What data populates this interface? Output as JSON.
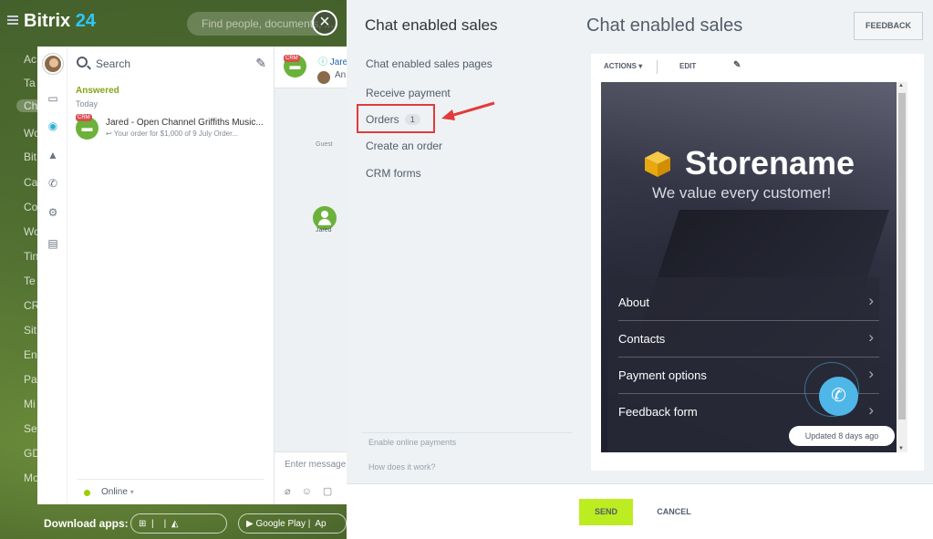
{
  "header": {
    "logo_main": "Bitrix",
    "logo_num": "24",
    "search_placeholder": "Find people, documents, ..."
  },
  "left_menu": [
    "Ac",
    "Ta",
    "Ch",
    "Wo",
    "Bit",
    "Ca",
    "Co",
    "Wo",
    "Tin",
    "Te",
    "CR",
    "Sit",
    "En",
    "Pa",
    "Mi",
    "Se",
    "GD",
    "Mo"
  ],
  "messenger": {
    "search_label": "Search",
    "section": "Answered",
    "date": "Today",
    "chat": {
      "badge": "CRM",
      "name": "Jared - Open Channel Griffiths Music...",
      "preview": "↩ Your order for $1,000 of 9 July Order..."
    },
    "status": "Online",
    "dialog": {
      "name": "Jare",
      "sub": "An",
      "guest_label": "Guest",
      "jared_label": "Jared",
      "input_placeholder": "Enter message"
    }
  },
  "download": {
    "label": "Download apps:",
    "google_play": "Google Play",
    "app_store": "Ap"
  },
  "panel": {
    "nav_title": "Chat enabled sales",
    "nav": {
      "pages": "Chat enabled sales pages",
      "receive": "Receive payment",
      "orders": "Orders",
      "orders_count": "1",
      "create": "Create an order",
      "crm_forms": "CRM forms"
    },
    "footer": {
      "enable": "Enable online payments",
      "how": "How does it work?"
    },
    "title": "Chat enabled sales",
    "feedback": "FEEDBACK",
    "toolbar": {
      "actions": "ACTIONS",
      "edit": "EDIT"
    },
    "preview": {
      "brand": "Storename",
      "tagline": "We value every customer!",
      "menu": [
        "About",
        "Contacts",
        "Payment options",
        "Feedback form"
      ],
      "updated": "Updated 8 days ago"
    },
    "send": "SEND",
    "cancel": "CANCEL"
  },
  "colors": {
    "accent_green": "#bbed21",
    "highlight_red": "#e23b3b",
    "link_blue": "#2067b0",
    "call_blue": "#4fb7e8"
  }
}
